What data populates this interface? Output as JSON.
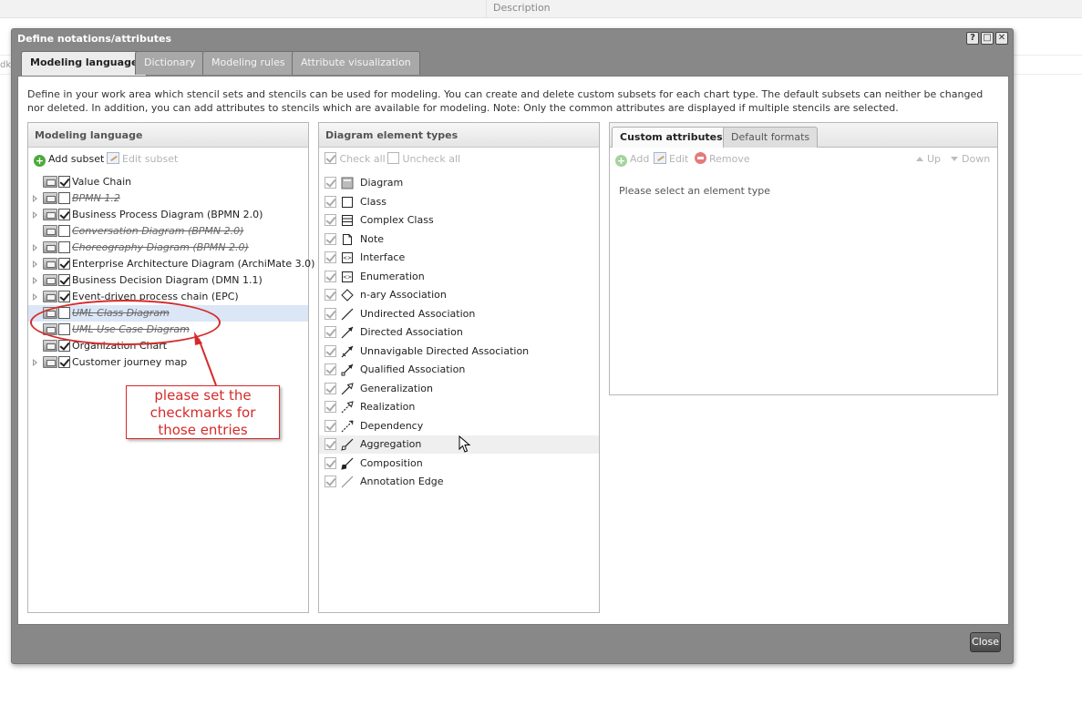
{
  "background": {
    "column_header": "Description",
    "left_fragment": "dk"
  },
  "dialog": {
    "title": "Define notations/attributes",
    "tabs": [
      "Modeling language",
      "Dictionary",
      "Modeling rules",
      "Attribute visualization"
    ],
    "intro": "Define in your work area which stencil sets and stencils can be used for modeling. You can create and delete custom subsets for each chart type. The default subsets can neither be changed nor deleted. In addition, you can add attributes to stencils which are available for modeling. Note: Only the common attributes are displayed if multiple stencils are selected.",
    "close_label": "Close"
  },
  "modeling_language": {
    "header": "Modeling language",
    "add_subset": "Add subset",
    "edit_subset": "Edit subset",
    "items": [
      {
        "label": "Value Chain",
        "checked": true,
        "strike": false,
        "expandable": false
      },
      {
        "label": "BPMN 1.2",
        "checked": false,
        "strike": true,
        "expandable": true
      },
      {
        "label": "Business Process Diagram (BPMN 2.0)",
        "checked": true,
        "strike": false,
        "expandable": true
      },
      {
        "label": "Conversation Diagram (BPMN 2.0)",
        "checked": false,
        "strike": true,
        "expandable": false
      },
      {
        "label": "Choreography Diagram (BPMN 2.0)",
        "checked": false,
        "strike": true,
        "expandable": true
      },
      {
        "label": "Enterprise Architecture Diagram (ArchiMate 3.0)",
        "checked": true,
        "strike": false,
        "expandable": true
      },
      {
        "label": "Business Decision Diagram (DMN 1.1)",
        "checked": true,
        "strike": false,
        "expandable": true
      },
      {
        "label": "Event-driven process chain (EPC)",
        "checked": true,
        "strike": false,
        "expandable": true
      },
      {
        "label": "UML Class Diagram",
        "checked": false,
        "strike": true,
        "expandable": false,
        "selected": true
      },
      {
        "label": "UML Use Case Diagram",
        "checked": false,
        "strike": true,
        "expandable": false
      },
      {
        "label": "Organization Chart",
        "checked": true,
        "strike": false,
        "expandable": false
      },
      {
        "label": "Customer journey map",
        "checked": true,
        "strike": false,
        "expandable": true
      }
    ]
  },
  "element_types": {
    "header": "Diagram element types",
    "check_all": "Check all",
    "uncheck_all": "Uncheck all",
    "items": [
      {
        "label": "Diagram",
        "icon": "diagram-icon"
      },
      {
        "label": "Class",
        "icon": "class-icon"
      },
      {
        "label": "Complex Class",
        "icon": "complex-class-icon"
      },
      {
        "label": "Note",
        "icon": "note-icon"
      },
      {
        "label": "Interface",
        "icon": "interface-icon"
      },
      {
        "label": "Enumeration",
        "icon": "enumeration-icon"
      },
      {
        "label": "n-ary Association",
        "icon": "diamond-icon"
      },
      {
        "label": "Undirected Association",
        "icon": "line-icon"
      },
      {
        "label": "Directed Association",
        "icon": "arrow-icon"
      },
      {
        "label": "Unnavigable Directed Association",
        "icon": "cross-arrow-icon"
      },
      {
        "label": "Qualified Association",
        "icon": "qualified-arrow-icon"
      },
      {
        "label": "Generalization",
        "icon": "generalization-icon"
      },
      {
        "label": "Realization",
        "icon": "realization-icon"
      },
      {
        "label": "Dependency",
        "icon": "dependency-icon"
      },
      {
        "label": "Aggregation",
        "icon": "aggregation-icon"
      },
      {
        "label": "Composition",
        "icon": "composition-icon"
      },
      {
        "label": "Annotation Edge",
        "icon": "annotation-edge-icon"
      }
    ]
  },
  "attributes": {
    "tabs": [
      "Custom attributes",
      "Default formats"
    ],
    "add": "Add",
    "edit": "Edit",
    "remove": "Remove",
    "up": "Up",
    "down": "Down",
    "empty_message": "Please select an element type"
  },
  "annotation": {
    "lines": [
      "please set the",
      "checkmarks for",
      "those entries"
    ],
    "color": "#d62a2a"
  }
}
